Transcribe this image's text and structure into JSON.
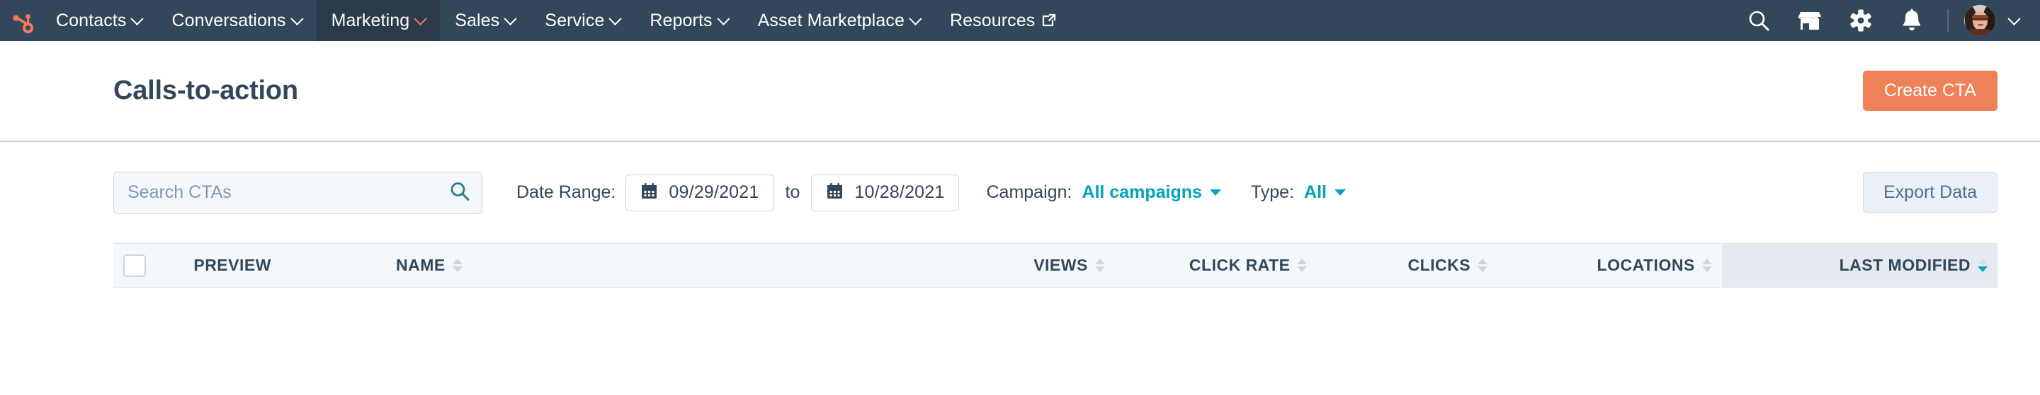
{
  "nav": {
    "logo_icon": "hubspot-sprocket-icon",
    "items": [
      {
        "label": "Contacts",
        "has_caret": true,
        "active": false,
        "external": false
      },
      {
        "label": "Conversations",
        "has_caret": true,
        "active": false,
        "external": false
      },
      {
        "label": "Marketing",
        "has_caret": true,
        "active": true,
        "external": false
      },
      {
        "label": "Sales",
        "has_caret": true,
        "active": false,
        "external": false
      },
      {
        "label": "Service",
        "has_caret": true,
        "active": false,
        "external": false
      },
      {
        "label": "Reports",
        "has_caret": true,
        "active": false,
        "external": false
      },
      {
        "label": "Asset Marketplace",
        "has_caret": true,
        "active": false,
        "external": false
      },
      {
        "label": "Resources",
        "has_caret": false,
        "active": false,
        "external": true
      }
    ],
    "right_icons": [
      {
        "name": "search-icon",
        "label": "Search"
      },
      {
        "name": "marketplace-icon",
        "label": "Marketplace"
      },
      {
        "name": "gear-icon",
        "label": "Settings"
      },
      {
        "name": "bell-icon",
        "label": "Notifications"
      }
    ],
    "avatar_alt": "User account avatar",
    "background_color": "#33475b",
    "active_background_color": "#2b3b4b",
    "accent_color": "#f2795a"
  },
  "header": {
    "title": "Calls-to-action",
    "create_button": "Create CTA",
    "create_button_color": "#ef8158"
  },
  "filters": {
    "search_placeholder": "Search CTAs",
    "search_value": "",
    "date_range_label": "Date Range:",
    "date_from": "09/29/2021",
    "date_to": "10/28/2021",
    "to_label": "to",
    "campaign_label": "Campaign:",
    "campaign_value": "All campaigns",
    "type_label": "Type:",
    "type_value": "All",
    "export_button": "Export Data",
    "link_color": "#00a4bd"
  },
  "table": {
    "select_all_checked": false,
    "columns": [
      {
        "key": "checkbox",
        "label": "",
        "sortable": false,
        "sorted": false,
        "align": "left"
      },
      {
        "key": "preview",
        "label": "PREVIEW",
        "sortable": false,
        "sorted": false,
        "align": "left"
      },
      {
        "key": "name",
        "label": "NAME",
        "sortable": true,
        "sorted": false,
        "align": "left"
      },
      {
        "key": "views",
        "label": "VIEWS",
        "sortable": true,
        "sorted": false,
        "align": "right"
      },
      {
        "key": "click_rate",
        "label": "CLICK RATE",
        "sortable": true,
        "sorted": false,
        "align": "right"
      },
      {
        "key": "clicks",
        "label": "CLICKS",
        "sortable": true,
        "sorted": false,
        "align": "right"
      },
      {
        "key": "locations",
        "label": "LOCATIONS",
        "sortable": true,
        "sorted": false,
        "align": "right"
      },
      {
        "key": "last_modified",
        "label": "LAST MODIFIED",
        "sortable": true,
        "sorted": true,
        "align": "right",
        "sort_direction": "desc"
      }
    ],
    "rows": []
  }
}
